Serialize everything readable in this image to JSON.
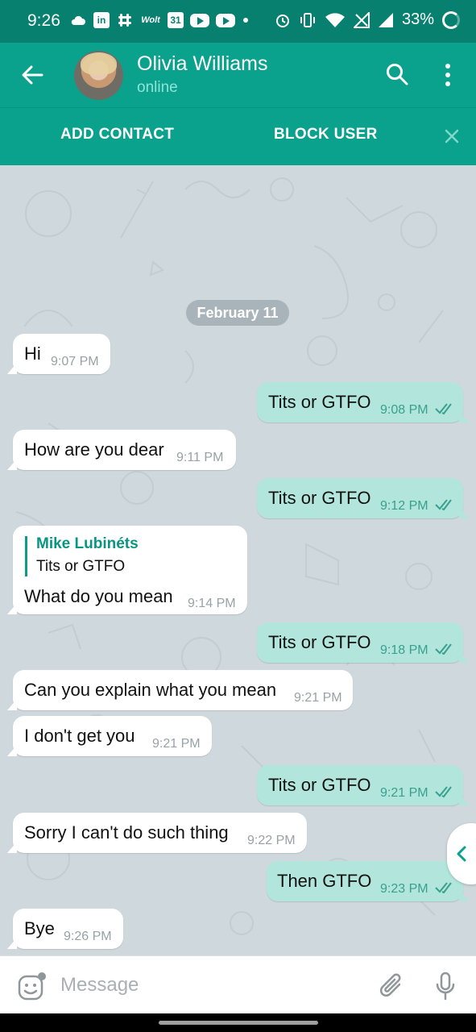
{
  "status_bar": {
    "time": "9:26",
    "battery": "33%",
    "icons": [
      "cloud-icon",
      "linkedin-icon",
      "slack-icon",
      "wolt-icon",
      "calendar-icon",
      "youtube-icon",
      "youtube-icon",
      "dot-icon",
      "alarm-icon",
      "vibrate-icon",
      "wifi-icon",
      "signal-off-icon",
      "signal-icon",
      "battery-icon"
    ],
    "wolt_label": "Wolt",
    "calendar_label": "31",
    "linkedin_label": "in"
  },
  "header": {
    "title": "Olivia Williams",
    "subtitle": "online"
  },
  "action_bar": {
    "add_contact": "ADD CONTACT",
    "block_user": "BLOCK USER"
  },
  "chat": {
    "date": "February 11",
    "messages": [
      {
        "dir": "in",
        "text": "Hi",
        "time": "9:07 PM"
      },
      {
        "dir": "out",
        "text": "Tits or GTFO",
        "time": "9:08 PM"
      },
      {
        "dir": "in",
        "text": "How are you dear",
        "time": "9:11 PM"
      },
      {
        "dir": "out",
        "text": "Tits or GTFO",
        "time": "9:12 PM"
      },
      {
        "dir": "in",
        "reply_name": "Mike Lubinéts",
        "reply_text": "Tits or GTFO",
        "text": "What do you mean",
        "time": "9:14 PM"
      },
      {
        "dir": "out",
        "text": "Tits or GTFO",
        "time": "9:18 PM"
      },
      {
        "dir": "in",
        "text": "Can you explain what you mean",
        "time": "9:21 PM"
      },
      {
        "dir": "in",
        "text": "I don't get you",
        "time": "9:21 PM"
      },
      {
        "dir": "out",
        "text": "Tits or GTFO",
        "time": "9:21 PM"
      },
      {
        "dir": "in",
        "text": "Sorry I can't do such thing",
        "time": "9:22 PM"
      },
      {
        "dir": "out",
        "text": "Then GTFO",
        "time": "9:23 PM"
      },
      {
        "dir": "in",
        "text": "Bye",
        "time": "9:26 PM"
      }
    ]
  },
  "input": {
    "placeholder": "Message",
    "value": ""
  },
  "colors": {
    "status_bar": "#07806f",
    "header": "#0aa18d",
    "outgoing_bubble": "#b2e6dc",
    "incoming_bubble": "#ffffff",
    "chat_background": "#cfd8dc"
  }
}
